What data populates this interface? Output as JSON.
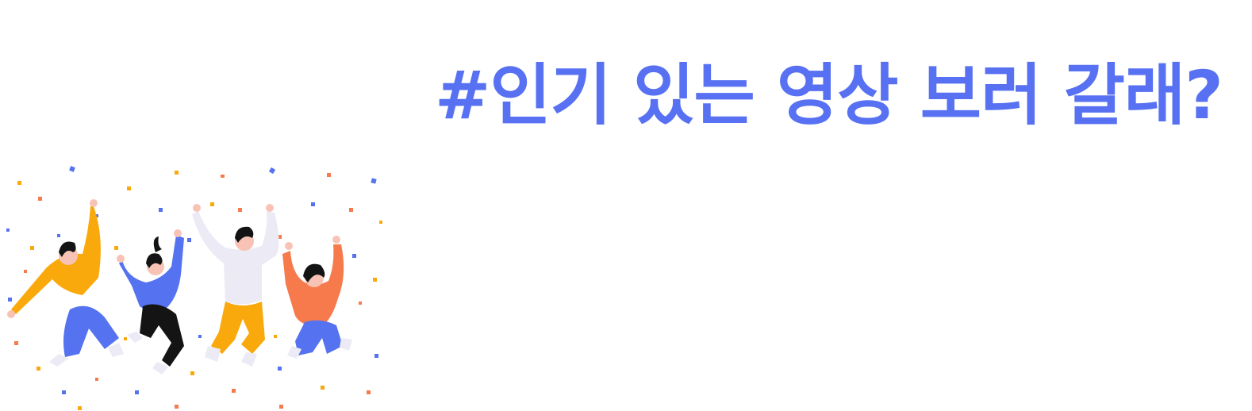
{
  "hero": {
    "headline": "#인기 있는 영상 보러 갈래?",
    "illustration": {
      "subject": "four people jumping with confetti"
    }
  },
  "colors": {
    "accent": "#5771F2",
    "yellow": "#F9A90C",
    "blue": "#5572F0",
    "orange": "#F67A4C",
    "black": "#141414",
    "light": "#ECEAF5",
    "skin": "#F8C3B4"
  }
}
